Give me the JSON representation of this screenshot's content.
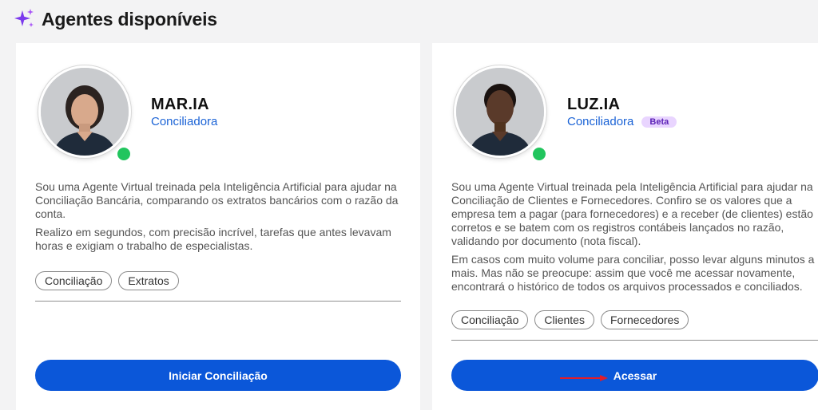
{
  "header": {
    "title": "Agentes disponíveis",
    "icon": "sparkles-icon",
    "icon_color": "#7c3aed"
  },
  "agents": [
    {
      "name": "MAR.IA",
      "role": "Conciliadora",
      "status": "online",
      "description": [
        "Sou uma Agente Virtual treinada pela Inteligência Artificial para ajudar na Conciliação Bancária, comparando os extratos bancários com o razão da conta.",
        "Realizo em segundos, com precisão incrível, tarefas que antes levavam horas e exigiam o trabalho de especialistas."
      ],
      "tags": [
        "Conciliação",
        "Extratos"
      ],
      "button": "Iniciar Conciliação"
    },
    {
      "name": "LUZ.IA",
      "role": "Conciliadora",
      "badge": "Beta",
      "status": "online",
      "description": [
        "Sou uma Agente Virtual treinada pela Inteligência Artificial para ajudar na Conciliação de Clientes e Fornecedores. Confiro se os valores que a empresa tem a pagar (para fornecedores) e a receber (de clientes) estão corretos e se batem com os registros contábeis lançados no razão, validando por documento (nota fiscal).",
        "Em casos com muito volume para conciliar, posso levar alguns minutos a mais. Mas não se preocupe: assim que você me acessar novamente, encontrará o histórico de todos os arquivos processados e conciliados."
      ],
      "tags": [
        "Conciliação",
        "Clientes",
        "Fornecedores"
      ],
      "button": "Acessar"
    }
  ],
  "colors": {
    "accent": "#0b57d9",
    "role": "#1b63d6",
    "online": "#22c55e",
    "annotation_arrow": "#e11d2a"
  }
}
